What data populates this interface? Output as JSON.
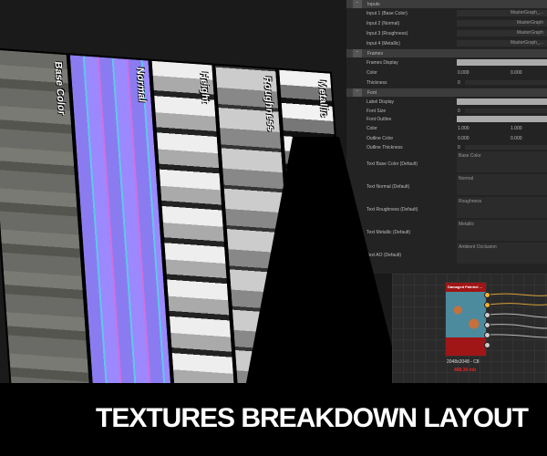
{
  "panel": {
    "inputs_header": "Inputs",
    "inputs": [
      {
        "label": "Input 1 (Base Color)",
        "value": "MasterGraph_..."
      },
      {
        "label": "Input 2 (Normal)",
        "value": "MasterGraph"
      },
      {
        "label": "Input 3 (Roughness)",
        "value": "MasterGraph"
      },
      {
        "label": "Input 4 (Metallic)",
        "value": "MasterGraph_..."
      }
    ],
    "frames_header": "Frames",
    "frames_display": "Frames Display",
    "frames_color": "Color",
    "frames_color_a": "0.000",
    "frames_color_b": "0.000",
    "frames_thickness": "Thickness",
    "frames_thickness_val": "0",
    "font_header": "Font",
    "label_display": "Label Display",
    "font_size": "Font Size",
    "font_size_val": "0",
    "font_outline": "Font Outline",
    "font_color": "Color",
    "font_color_a": "1.000",
    "font_color_b": "1.000",
    "outline_color": "Outline Color",
    "outline_color_a": "0.000",
    "outline_color_b": "0.000",
    "outline_thickness": "Outline Thickness",
    "outline_thickness_val": "0",
    "defaults": [
      {
        "label": "Text Base Color (Default)",
        "value": "Base Color"
      },
      {
        "label": "Text Normal (Default)",
        "value": "Normal"
      },
      {
        "label": "Text Roughness (Default)",
        "value": "Roughness"
      },
      {
        "label": "Text Metallic (Default)",
        "value": "Metallic"
      },
      {
        "label": "Text AO (Default)",
        "value": "Ambient Occlusion"
      }
    ]
  },
  "node": {
    "title": "Damaged Painted ...",
    "resolution": "2048x2048 - C8",
    "size": "468.34 mb"
  },
  "textures": [
    "Base Color",
    "Normal",
    "Height",
    "Roughness",
    "Metallic"
  ],
  "title": "TEXTURES BREAKDOWN LAYOUT"
}
